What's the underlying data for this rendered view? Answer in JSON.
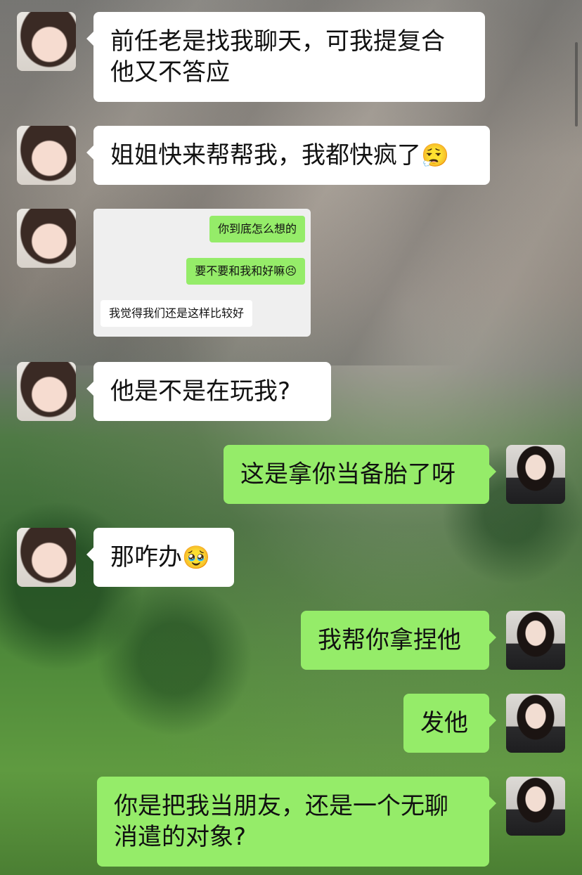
{
  "messages": [
    {
      "side": "in",
      "text": "前任老是找我聊天，可我提复合他又不答应"
    },
    {
      "side": "in",
      "text": "姐姐快来帮帮我，我都快疯了",
      "emoji": "😮‍💨"
    },
    {
      "side": "in",
      "type": "image"
    },
    {
      "side": "in",
      "text": "他是不是在玩我?"
    },
    {
      "side": "out",
      "text": "这是拿你当备胎了呀"
    },
    {
      "side": "in",
      "text": "那咋办",
      "emoji": "🥹"
    },
    {
      "side": "out",
      "text": "我帮你拿捏他"
    },
    {
      "side": "out",
      "text": "发他"
    },
    {
      "side": "out",
      "text": "你是把我当朋友，还是一个无聊消遣的对象?"
    }
  ],
  "screenshot": {
    "msg1": "你到底怎么想的",
    "msg2": "要不要和我和好嘛",
    "msg2_emoji": "😣",
    "msg3": "我觉得我们还是这样比较好"
  },
  "lines": {
    "m1_line1": "前任老是找我聊天，可我提复合",
    "m1_line2": "他又不答应",
    "m9_line1": "你是把我当朋友，还是一个无聊",
    "m9_line2": "消遣的对象?"
  },
  "colors": {
    "outgoing_bubble": "#95ec69",
    "incoming_bubble": "#ffffff"
  }
}
